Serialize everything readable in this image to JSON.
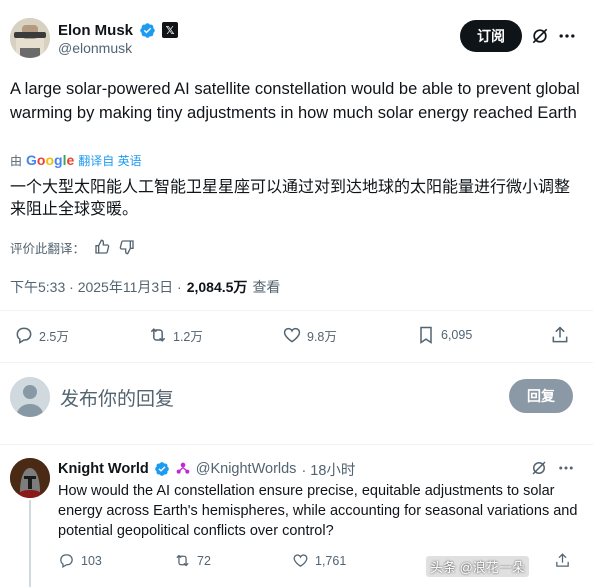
{
  "colors": {
    "text_primary": "#0f1419",
    "text_secondary": "#536471",
    "verified_blue": "#1d9bf0",
    "link_blue": "#1d9bf0",
    "subscribe_bg": "#0f1419",
    "reply_button_bg": "#8b98a5",
    "divider": "#eff3f4"
  },
  "post": {
    "author_name": "Elon Musk",
    "author_handle": "@elonmusk",
    "verified_icon": "verified-badge-icon",
    "affiliate_icon": "x-logo-icon",
    "subscribe_label": "订阅",
    "text": "A large solar-powered AI satellite constellation would be able to prevent global warming by making tiny adjustments in how much solar energy reached Earth",
    "translated_prefix": "由",
    "translated_service": "Google",
    "translated_suffix": "翻译自 英语",
    "translation": "一个大型太阳能人工智能卫星星座可以通过对到达地球的太阳能量进行微小调整来阻止全球变暖。",
    "rate_label": "评价此翻译：",
    "timestamp": "下午5:33 · 2025年11月3日 ·",
    "views": "2,084.5万",
    "views_label": "查看",
    "stats": {
      "replies": "2.5万",
      "reposts": "1.2万",
      "likes": "9.8万",
      "bookmarks": "6,095"
    }
  },
  "composer": {
    "placeholder": "发布你的回复",
    "reply_button": "回复"
  },
  "reply": {
    "author_name": "Knight World",
    "author_handle": "@KnightWorlds",
    "time": "· 18小时",
    "text": "How would the AI constellation ensure precise, equitable adjustments to solar energy across Earth's hemispheres, while accounting for seasonal variations and potential geopolitical conflicts over control?",
    "stats": {
      "replies": "103",
      "reposts": "72",
      "likes": "1,761"
    }
  },
  "watermark": "头条 @浪花一朵"
}
